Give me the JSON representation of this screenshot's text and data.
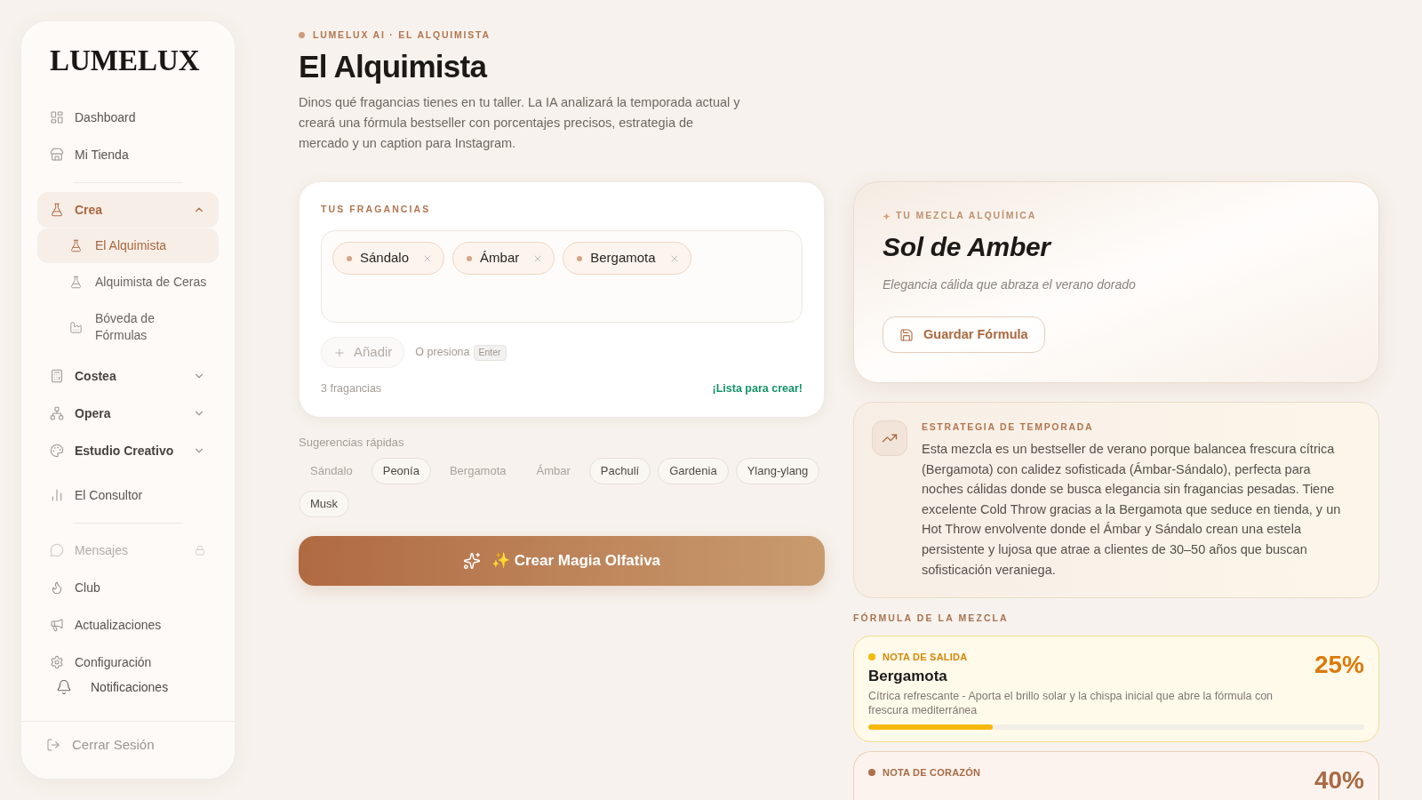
{
  "sidebar": {
    "logo": "LUMELUX",
    "sections": [
      {
        "items": [
          {
            "kind": "link",
            "label": "Dashboard",
            "selected": false
          },
          {
            "kind": "link",
            "label": "Mi Tienda",
            "selected": false
          }
        ]
      },
      {
        "items": [
          {
            "kind": "group",
            "label": "Crea",
            "selected": true,
            "expanded": true,
            "children": [
              {
                "label": "El Alquimista",
                "selected": true
              },
              {
                "label": "Alquimista de Ceras",
                "selected": false
              },
              {
                "label": "Bóveda de Fórmulas",
                "selected": false
              }
            ]
          },
          {
            "kind": "group",
            "label": "Costea",
            "selected": false,
            "expanded": false
          },
          {
            "kind": "group",
            "label": "Opera",
            "selected": false,
            "expanded": false
          },
          {
            "kind": "group",
            "label": "Estudio Creativo",
            "selected": false,
            "expanded": false
          },
          {
            "kind": "link",
            "label": "El Consultor",
            "selected": false
          }
        ]
      },
      {
        "items": [
          {
            "kind": "link",
            "label": "Mensajes",
            "selected": false,
            "locked": true
          },
          {
            "kind": "link",
            "label": "Club",
            "selected": false,
            "locked": false
          },
          {
            "kind": "link",
            "label": "Actualizaciones",
            "selected": false,
            "locked": false
          },
          {
            "kind": "link",
            "label": "Configuración",
            "selected": false,
            "locked": false
          }
        ]
      }
    ],
    "notifications": "Notificaciones",
    "logout": "Cerrar Sesión"
  },
  "header": {
    "eyebrow": "LUMELUX AI · EL ALQUIMISTA",
    "title": "El Alquimista",
    "description": "Dinos qué fragancias tienes en tu taller. La IA analizará la temporada actual y creará una fórmula bestseller con porcentajes precisos, estrategia de mercado y un caption para Instagram."
  },
  "fragrances": {
    "label": "TUS FRAGANCIAS",
    "tags": [
      {
        "label": "Sándalo"
      },
      {
        "label": "Ámbar"
      },
      {
        "label": "Bergamota"
      }
    ],
    "add_button": {
      "label": "Añadir",
      "disabled": true
    },
    "hint": "O presiona",
    "key": "Enter",
    "count": "3 fragancias",
    "status": "¡Lista para crear!"
  },
  "suggestions": {
    "label": "Sugerencias rápidas",
    "items": [
      {
        "label": "Sándalo",
        "disabled": true
      },
      {
        "label": "Peonía",
        "disabled": false
      },
      {
        "label": "Bergamota",
        "disabled": true
      },
      {
        "label": "Ámbar",
        "disabled": true
      },
      {
        "label": "Pachulí",
        "disabled": false
      },
      {
        "label": "Gardenia",
        "disabled": false
      },
      {
        "label": "Ylang-ylang",
        "disabled": false
      },
      {
        "label": "Musk",
        "disabled": false
      }
    ]
  },
  "create_button": "✨ Crear Magia Olfativa",
  "result": {
    "eyebrow": "TU MEZCLA ALQUÍMICA",
    "name": "Sol de Amber",
    "tagline": "Elegancia cálida que abraza el verano dorado",
    "save_button": "Guardar Fórmula"
  },
  "strategy": {
    "label": "ESTRATEGIA DE TEMPORADA",
    "text": "Esta mezcla es un bestseller de verano porque balancea frescura cítrica (Bergamota) con calidez sofisticada (Ámbar-Sándalo), perfecta para noches cálidas donde se busca elegancia sin fragancias pesadas. Tiene excelente Cold Throw gracias a la Bergamota que seduce en tienda, y un Hot Throw envolvente donde el Ámbar y Sándalo crean una estela persistente y lujosa que atrae a clientes de 30–50 años que buscan sofisticación veraniega."
  },
  "formula": {
    "label": "FÓRMULA DE LA MEZCLA",
    "notes": [
      {
        "kind": "top",
        "label": "NOTA DE SALIDA",
        "name": "Bergamota",
        "description": "Cítrica refrescante - Aporta el brillo solar y la chispa inicial que abre la fórmula con frescura mediterránea",
        "percent": "25%",
        "level": 0.25,
        "color": "#f5b80b"
      },
      {
        "kind": "heart",
        "label": "NOTA DE CORAZÓN",
        "percent": "40%",
        "color": "#b06f4a"
      }
    ]
  }
}
